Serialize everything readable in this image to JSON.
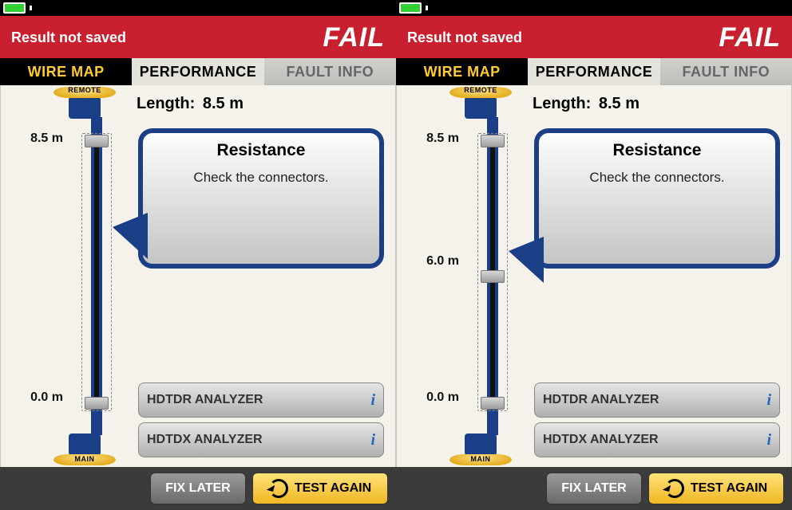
{
  "devices": [
    {
      "header": {
        "save_state": "Result not saved",
        "result": "FAIL"
      },
      "tabs": {
        "wiremap": "WIRE MAP",
        "performance": "PERFORMANCE",
        "faultinfo": "FAULT INFO"
      },
      "length": {
        "label": "Length:",
        "value": "8.5 m"
      },
      "endpoints": {
        "remote": "REMOTE",
        "main": "MAIN"
      },
      "markers": [
        {
          "distance": "8.5 m",
          "frac": 0.05
        },
        {
          "distance": "0.0 m",
          "frac": 0.93
        }
      ],
      "callout": {
        "title": "Resistance",
        "msg": "Check the connectors.",
        "tail_frac": 0.6
      },
      "analyzers": {
        "hdtdr": "HDTDR ANALYZER",
        "hdtdx": "HDTDX ANALYZER"
      },
      "buttons": {
        "fix": "FIX LATER",
        "test": "TEST AGAIN"
      }
    },
    {
      "header": {
        "save_state": "Result not saved",
        "result": "FAIL"
      },
      "tabs": {
        "wiremap": "WIRE MAP",
        "performance": "PERFORMANCE",
        "faultinfo": "FAULT INFO"
      },
      "length": {
        "label": "Length:",
        "value": "8.5 m"
      },
      "endpoints": {
        "remote": "REMOTE",
        "main": "MAIN"
      },
      "markers": [
        {
          "distance": "8.5 m",
          "frac": 0.05
        },
        {
          "distance": "6.0 m",
          "frac": 0.5
        },
        {
          "distance": "0.0 m",
          "frac": 0.93
        }
      ],
      "callout": {
        "title": "Resistance",
        "msg": "Check the connectors.",
        "tail_frac": 0.8
      },
      "analyzers": {
        "hdtdr": "HDTDR ANALYZER",
        "hdtdx": "HDTDX ANALYZER"
      },
      "buttons": {
        "fix": "FIX LATER",
        "test": "TEST AGAIN"
      }
    }
  ]
}
